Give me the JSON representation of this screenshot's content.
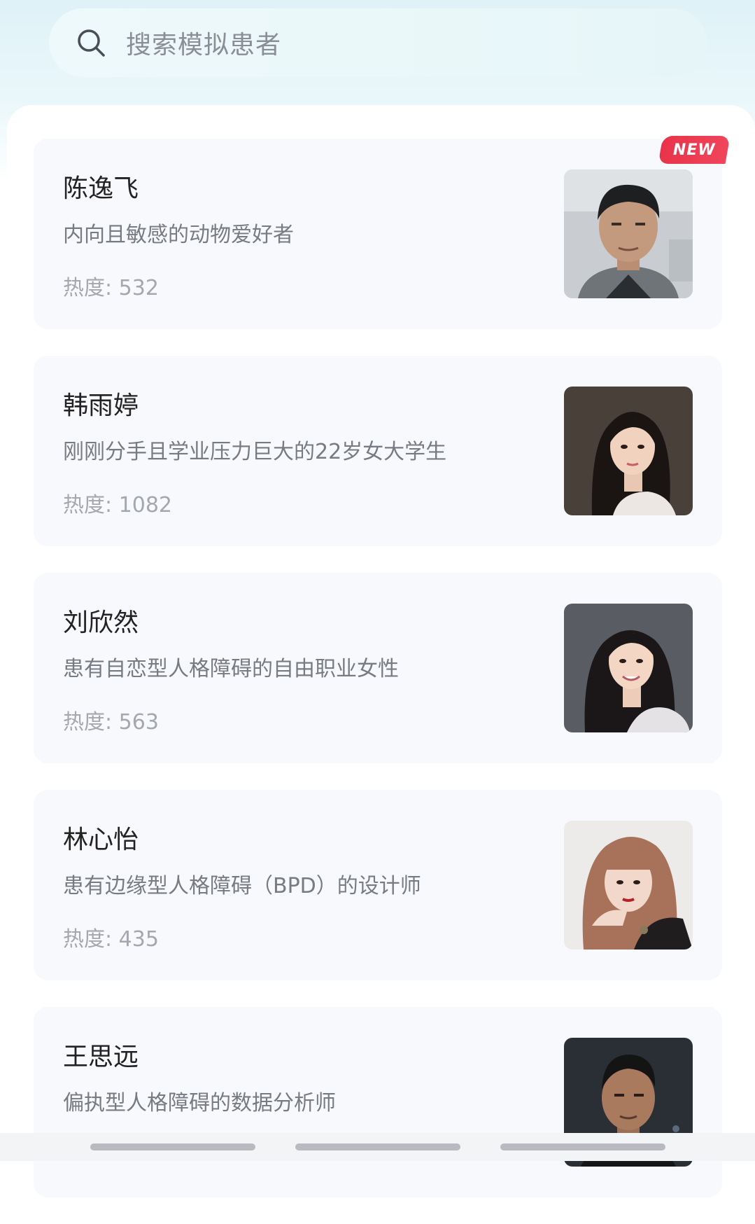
{
  "search": {
    "placeholder": "搜索模拟患者"
  },
  "badge_new": "NEW",
  "patients": [
    {
      "name": "陈逸飞",
      "desc": "内向且敏感的动物爱好者",
      "heat": "热度: 532",
      "is_new": true
    },
    {
      "name": "韩雨婷",
      "desc": "刚刚分手且学业压力巨大的22岁女大学生",
      "heat": "热度: 1082",
      "is_new": false
    },
    {
      "name": "刘欣然",
      "desc": "患有自恋型人格障碍的自由职业女性",
      "heat": "热度: 563",
      "is_new": false
    },
    {
      "name": "林心怡",
      "desc": "患有边缘型人格障碍（BPD）的设计师",
      "heat": "热度: 435",
      "is_new": false
    },
    {
      "name": "王思远",
      "desc": "偏执型人格障碍的数据分析师",
      "heat": "",
      "is_new": false
    }
  ],
  "colors": {
    "accent_new": "#e8344a",
    "search_bg": "#eef9fb"
  }
}
